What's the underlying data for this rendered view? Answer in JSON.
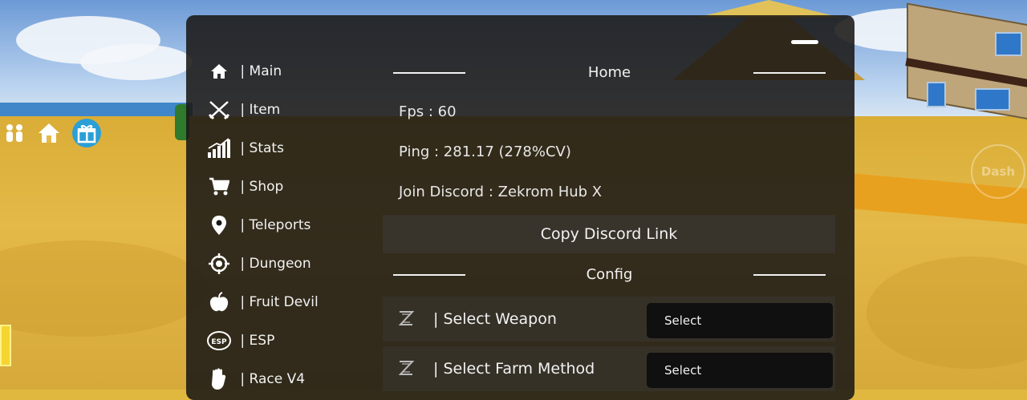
{
  "window": {
    "minimize_label": ""
  },
  "sidebar": {
    "items": [
      {
        "label": " | Main",
        "icon": "home-icon"
      },
      {
        "label": " | Item",
        "icon": "crossed-swords-icon"
      },
      {
        "label": " | Stats",
        "icon": "stats-chart-icon"
      },
      {
        "label": " | Shop",
        "icon": "shopping-cart-icon"
      },
      {
        "label": " | Teleports",
        "icon": "location-pin-icon"
      },
      {
        "label": " | Dungeon",
        "icon": "crosshair-icon"
      },
      {
        "label": " | Fruit Devil",
        "icon": "apple-icon"
      },
      {
        "label": " | ESP",
        "icon": "esp-icon"
      },
      {
        "label": " | Race V4",
        "icon": "fist-icon"
      }
    ]
  },
  "content": {
    "home_title": "Home",
    "fps": "Fps : 60",
    "ping": "Ping : 281.17 (278%CV)",
    "discord": "Join Discord : Zekrom Hub X",
    "copy_button": "Copy Discord Link",
    "config_title": "Config",
    "dropdowns": [
      {
        "label": " | Select Weapon",
        "value": "Select"
      },
      {
        "label": " | Select Farm Method",
        "value": "Select"
      }
    ]
  },
  "hud": {
    "dash_label": "Dash"
  },
  "colors": {
    "panel_bg": "#1a1816",
    "select_bg": "#101010",
    "text": "#f2f2f2"
  }
}
